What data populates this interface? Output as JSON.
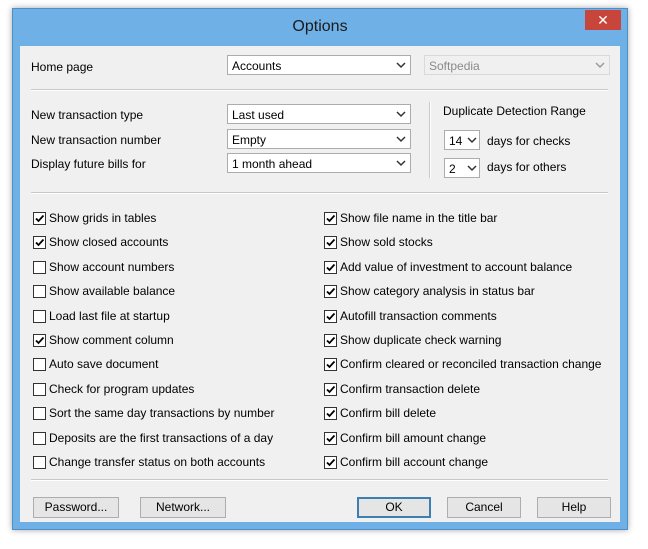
{
  "window": {
    "title": "Options",
    "close_glyph": "✕"
  },
  "home": {
    "label": "Home page",
    "value": "Accounts",
    "secondary_value": "Softpedia"
  },
  "transactions": {
    "type_label": "New transaction type",
    "type_value": "Last used",
    "number_label": "New transaction number",
    "number_value": "Empty",
    "future_label": "Display future bills for",
    "future_value": "1 month ahead"
  },
  "duplicate": {
    "title": "Duplicate Detection Range",
    "checks_value": "14",
    "checks_label": "days for checks",
    "others_value": "2",
    "others_label": "days for others"
  },
  "checkboxes_left": [
    {
      "label": "Show grids in tables",
      "checked": true
    },
    {
      "label": "Show closed accounts",
      "checked": true
    },
    {
      "label": "Show account numbers",
      "checked": false
    },
    {
      "label": "Show available balance",
      "checked": false
    },
    {
      "label": "Load last file at startup",
      "checked": false
    },
    {
      "label": "Show comment column",
      "checked": true
    },
    {
      "label": "Auto save document",
      "checked": false
    },
    {
      "label": "Check for program updates",
      "checked": false
    },
    {
      "label": "Sort the same day transactions by number",
      "checked": false
    },
    {
      "label": "Deposits are the first transactions of a day",
      "checked": false
    },
    {
      "label": "Change transfer status on both accounts",
      "checked": false
    }
  ],
  "checkboxes_right": [
    {
      "label": "Show file name in the title bar",
      "checked": true
    },
    {
      "label": "Show sold stocks",
      "checked": true
    },
    {
      "label": "Add value of investment to account balance",
      "checked": true
    },
    {
      "label": "Show category analysis in status bar",
      "checked": true
    },
    {
      "label": "Autofill transaction comments",
      "checked": true
    },
    {
      "label": "Show duplicate check warning",
      "checked": true
    },
    {
      "label": "Confirm cleared or reconciled transaction change",
      "checked": true
    },
    {
      "label": "Confirm transaction delete",
      "checked": true
    },
    {
      "label": "Confirm bill delete",
      "checked": true
    },
    {
      "label": "Confirm bill amount change",
      "checked": true
    },
    {
      "label": "Confirm bill account change",
      "checked": true
    }
  ],
  "buttons": {
    "password": "Password...",
    "network": "Network...",
    "ok": "OK",
    "cancel": "Cancel",
    "help": "Help"
  }
}
